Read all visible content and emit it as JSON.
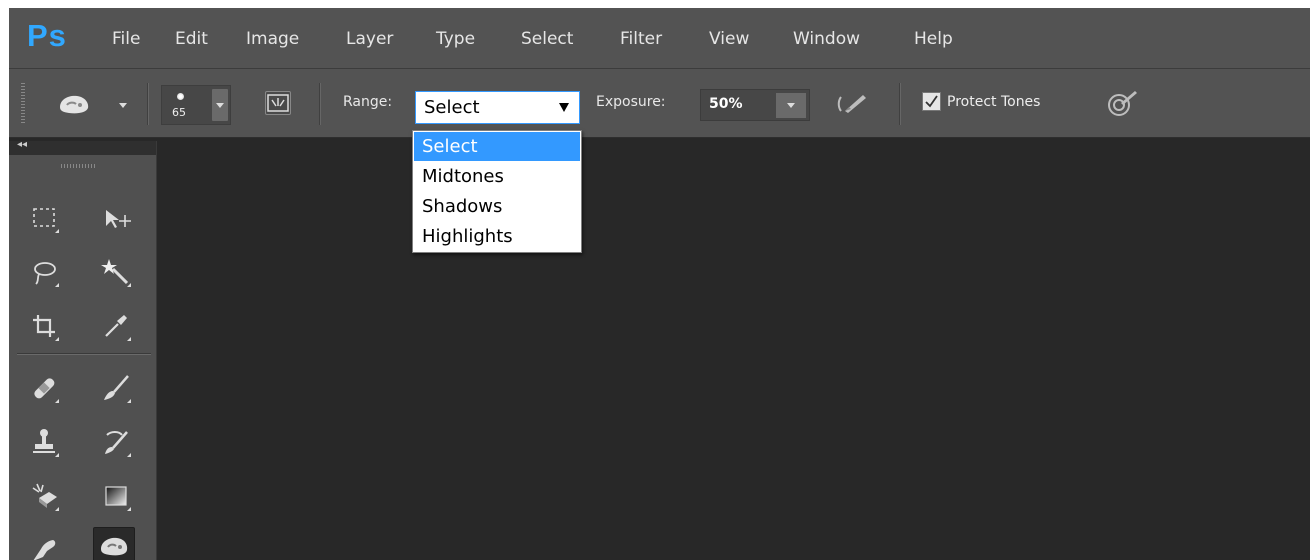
{
  "app": {
    "logo": "Ps"
  },
  "menubar": {
    "items": [
      "File",
      "Edit",
      "Image",
      "Layer",
      "Type",
      "Select",
      "Filter",
      "View",
      "Window",
      "Help"
    ]
  },
  "options_bar": {
    "brush_size": "65",
    "range_label": "Range:",
    "range_value": "Select",
    "exposure_label": "Exposure:",
    "exposure_value": "50%",
    "protect_tones_label": "Protect Tones",
    "protect_tones_checked": true
  },
  "range_dropdown": {
    "options": [
      "Select",
      "Midtones",
      "Shadows",
      "Highlights"
    ],
    "selected_index": 0
  },
  "tools": [
    {
      "icon": "rectangular-marquee-icon"
    },
    {
      "icon": "move-tool-icon"
    },
    {
      "icon": "lasso-tool-icon"
    },
    {
      "icon": "magic-wand-icon"
    },
    {
      "icon": "crop-tool-icon"
    },
    {
      "icon": "eyedropper-icon"
    },
    {
      "icon": "healing-brush-icon"
    },
    {
      "icon": "brush-tool-icon"
    },
    {
      "icon": "clone-stamp-icon"
    },
    {
      "icon": "history-brush-icon"
    },
    {
      "icon": "eraser-tool-icon"
    },
    {
      "icon": "gradient-tool-icon"
    },
    {
      "icon": "smudge-tool-icon"
    },
    {
      "icon": "dodge-tool-icon"
    }
  ],
  "colors": {
    "accent": "#3399ff",
    "logo": "#31a8ff",
    "chrome": "#535353",
    "canvas": "#282828"
  }
}
